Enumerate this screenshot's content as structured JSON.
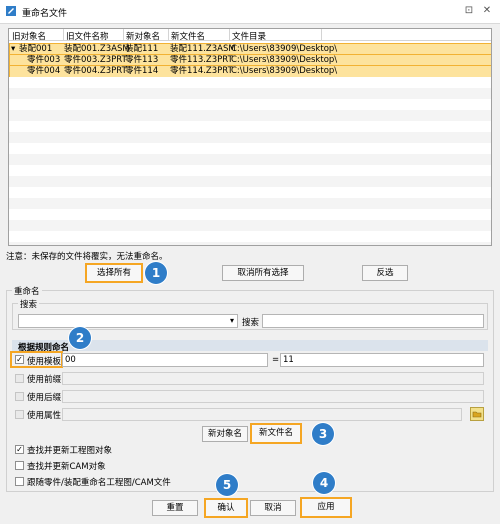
{
  "window": {
    "title": "重命名文件",
    "pin_icon": "pin-icon",
    "close_label": "✕"
  },
  "grid": {
    "columns": [
      "旧对象名",
      "旧文件名称",
      "新对象名",
      "新文件名",
      "文件目录"
    ],
    "rows": [
      {
        "old_obj": "装配001",
        "old_file": "装配001.Z3ASM",
        "new_obj": "装配111",
        "new_file": "装配111.Z3ASM",
        "dir": "C:\\Users\\83909\\Desktop\\"
      },
      {
        "old_obj": "零件003",
        "old_file": "零件003.Z3PRT",
        "new_obj": "零件113",
        "new_file": "零件113.Z3PRT",
        "dir": "C:\\Users\\83909\\Desktop\\"
      },
      {
        "old_obj": "零件004",
        "old_file": "零件004.Z3PRT",
        "new_obj": "零件114",
        "new_file": "零件114.Z3PRT",
        "dir": "C:\\Users\\83909\\Desktop\\"
      }
    ]
  },
  "note": "注意：未保存的文件将覆实，无法重命名。",
  "selection_buttons": {
    "select_all": "选择所有",
    "deselect_all": "取消所有选择",
    "invert": "反选"
  },
  "rename_group": {
    "title": "重命名",
    "search_group_title": "搜索",
    "search_label": "搜索",
    "rules_title": "根据规则命名",
    "rules": [
      {
        "label": "使用模板",
        "checked": true,
        "value": "00",
        "equals": "=",
        "value2": "11"
      },
      {
        "label": "使用前缀",
        "checked": false
      },
      {
        "label": "使用后缀",
        "checked": false
      },
      {
        "label": "使用属性",
        "checked": false
      }
    ],
    "name_buttons": {
      "new_object_name": "新对象名",
      "new_file_name": "新文件名"
    },
    "options": [
      {
        "label": "查找并更新工程图对象",
        "checked": true
      },
      {
        "label": "查找并更新CAM对象",
        "checked": false
      },
      {
        "label": "跟随零件/装配重命名工程图/CAM文件",
        "checked": false
      }
    ]
  },
  "footer": {
    "reset": "重置",
    "confirm": "确认",
    "cancel": "取消",
    "apply": "应用"
  },
  "badges": [
    "1",
    "2",
    "3",
    "4",
    "5"
  ],
  "colors": {
    "highlight": "#f5a623",
    "badge": "#2f7dc8",
    "selected_row": "#fde39d"
  }
}
